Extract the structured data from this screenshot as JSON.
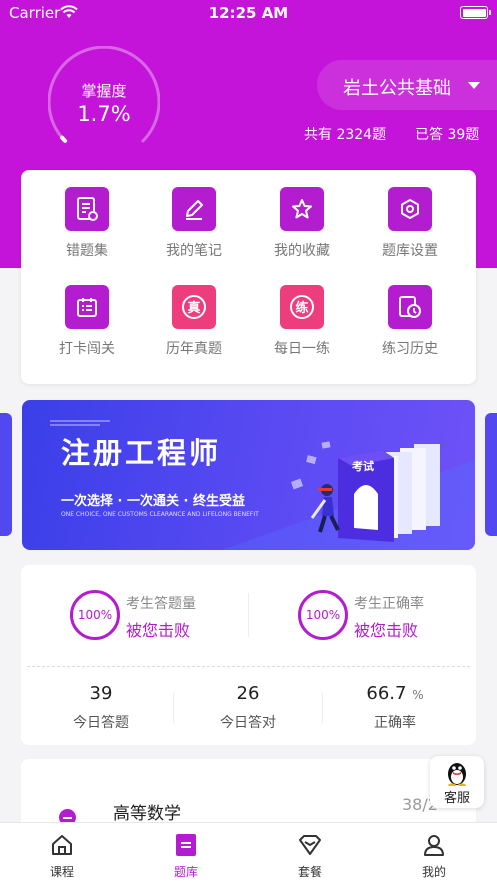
{
  "status_bar": {
    "carrier": "Carrier",
    "time": "12:25 AM"
  },
  "progress": {
    "label": "掌握度",
    "value": "1.7%",
    "fraction": 0.017
  },
  "subject": {
    "name": "岩土公共基础"
  },
  "counts": {
    "total": "共有 2324题",
    "answered": "已答 39题"
  },
  "menu": [
    {
      "label": "错题集",
      "icon": "wrong-book-icon"
    },
    {
      "label": "我的笔记",
      "icon": "pencil-icon"
    },
    {
      "label": "我的收藏",
      "icon": "star-icon"
    },
    {
      "label": "题库设置",
      "icon": "settings-icon"
    },
    {
      "label": "打卡闯关",
      "icon": "calendar-icon"
    },
    {
      "label": "历年真题",
      "icon": "real-exam-icon",
      "glyph": "真"
    },
    {
      "label": "每日一练",
      "icon": "daily-practice-icon",
      "glyph": "练"
    },
    {
      "label": "练习历史",
      "icon": "history-icon"
    }
  ],
  "banner": {
    "title": "注册工程师",
    "subtitle": "一次选择 · 一次通关 · 终生受益",
    "subtitle_en": "ONE CHOICE, ONE CUSTOMS CLEARANCE AND LIFELONG BENEFIT",
    "book_label": "考试"
  },
  "rank": {
    "left": {
      "badge": "100%",
      "label": "考生答题量",
      "value": "被您击败"
    },
    "right": {
      "badge": "100%",
      "label": "考生正确率",
      "value": "被您击败"
    }
  },
  "today": [
    {
      "value": "39",
      "unit": "",
      "label": "今日答题"
    },
    {
      "value": "26",
      "unit": "",
      "label": "今日答对"
    },
    {
      "value": "66.7",
      "unit": "%",
      "label": "正确率"
    }
  ],
  "course": {
    "name": "高等数学",
    "progress": "38/2"
  },
  "support": {
    "label": "客服"
  },
  "tabs": [
    {
      "label": "课程",
      "icon": "home-icon"
    },
    {
      "label": "题库",
      "icon": "question-bank-icon"
    },
    {
      "label": "套餐",
      "icon": "package-icon"
    },
    {
      "label": "我的",
      "icon": "profile-icon"
    }
  ],
  "colors": {
    "brand": "#c514d9",
    "accent": "#b41ccf",
    "pink": "#ee3d7c",
    "banner": "#4a44ee"
  }
}
